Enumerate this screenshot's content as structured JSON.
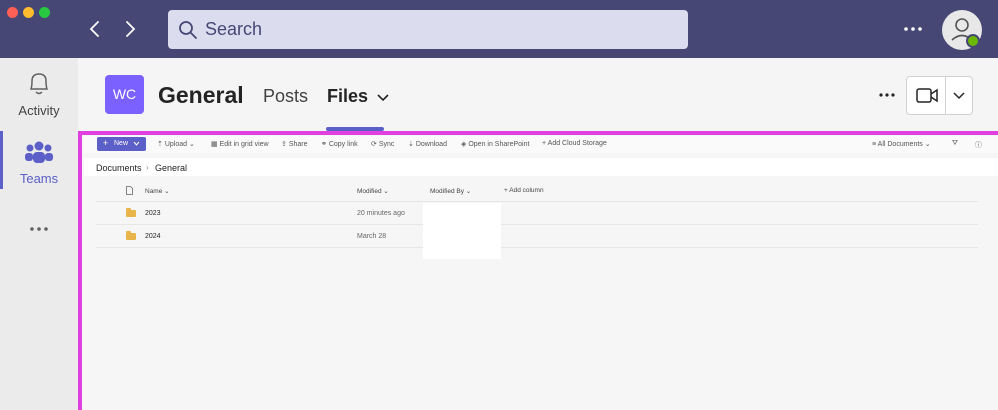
{
  "window": {
    "traffic_lights": [
      "#ff5f57",
      "#febc2e",
      "#28c840"
    ]
  },
  "search": {
    "placeholder": "Search"
  },
  "rail": {
    "items": [
      {
        "label": "Activity",
        "icon": "bell-icon"
      },
      {
        "label": "Teams",
        "icon": "teams-icon",
        "active": true
      }
    ],
    "more_icon": "more-icon"
  },
  "channel": {
    "team_initials": "WC",
    "title": "General",
    "tabs": [
      {
        "label": "Posts",
        "active": false
      },
      {
        "label": "Files",
        "active": true
      }
    ]
  },
  "toolbar": {
    "new_label": "New",
    "upload_label": "Upload",
    "grid_label": "Edit in grid view",
    "share_label": "Share",
    "copy_link_label": "Copy link",
    "sync_label": "Sync",
    "download_label": "Download",
    "sharepoint_label": "Open in SharePoint",
    "cloud_label": "Add Cloud Storage",
    "view_label": "All Documents"
  },
  "breadcrumb": {
    "root": "Documents",
    "current": "General"
  },
  "columns": {
    "name": "Name",
    "modified": "Modified",
    "modified_by": "Modified By",
    "add_column": "Add column"
  },
  "rows": [
    {
      "name": "2023",
      "modified": "20 minutes ago"
    },
    {
      "name": "2024",
      "modified": "March 28"
    }
  ],
  "colors": {
    "brand": "#464775",
    "accent": "#5b5fc7",
    "highlight": "#e040e0",
    "team_avatar": "#7b61ff"
  }
}
